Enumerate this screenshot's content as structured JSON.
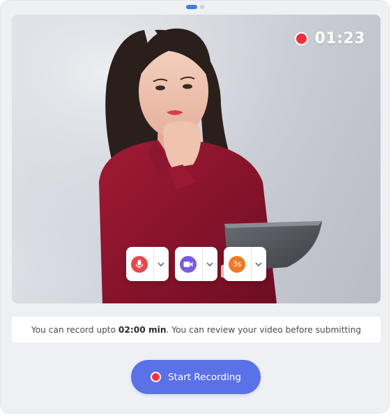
{
  "recorder": {
    "timer": "01:23",
    "colors": {
      "record_red": "#ef2f3b",
      "primary_button": "#5b71e8",
      "pager_active": "#3f7be6",
      "mic": "#e5484d",
      "camera": "#7a5be0",
      "countdown": "#f07a24"
    }
  },
  "pager": {
    "total": 2,
    "active_index": 0
  },
  "controls": {
    "microphone": {
      "icon": "microphone-icon",
      "dropdown_icon": "chevron-down-icon"
    },
    "camera": {
      "icon": "video-camera-icon",
      "dropdown_icon": "chevron-down-icon"
    },
    "countdown": {
      "icon": "countdown-timer-icon",
      "label": "3s",
      "dropdown_icon": "chevron-down-icon"
    }
  },
  "info": {
    "prefix": "You can record upto ",
    "limit": "02:00 min",
    "suffix": ". You can review your video before submitting"
  },
  "start_button": {
    "label": "Start Recording",
    "icon": "record-dot-icon"
  }
}
